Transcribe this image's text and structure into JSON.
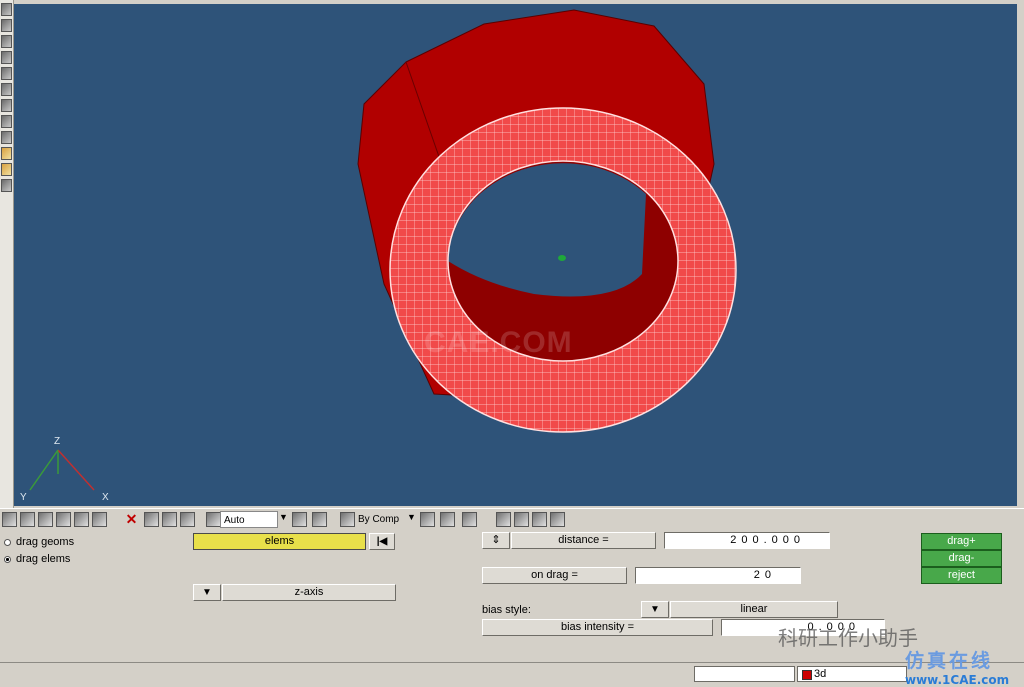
{
  "viewport": {
    "watermark": "CAE.COM",
    "axes": {
      "z_label": "Z",
      "y_label": "Y",
      "x_label": "X"
    },
    "colors": {
      "background": "#2e5379",
      "cylinder": "#b10000",
      "ring_face": "#f14a4a",
      "mesh": "#ffd8d8"
    }
  },
  "toolbar": {
    "icons": [
      "select-icon",
      "edit-icon",
      "folder-icon",
      "save-icon",
      "import-icon",
      "export-icon"
    ],
    "delete_icon": "delete-icon",
    "pick_mode": "Auto",
    "color_mode": "By Comp"
  },
  "panel": {
    "radio_drag_geoms": "drag geoms",
    "radio_drag_elems": "drag elems",
    "elems_button": "elems",
    "reset_glyph": "|◀",
    "dropdown_glyph": "▼",
    "direction_button": "z-axis",
    "updown_glyph": "⇕",
    "distance_label": "distance =",
    "distance_value": "200.000",
    "on_drag_label": "on drag =",
    "on_drag_value": "20",
    "bias_style_label": "bias style:",
    "bias_style_value": "linear",
    "bias_intensity_label": "bias intensity =",
    "bias_intensity_value": "0.000",
    "drag_plus": "drag+",
    "drag_minus": "drag-",
    "reject": "reject"
  },
  "status": {
    "component": "3d",
    "component_color": "#cc0000"
  },
  "overlay_watermark": "科研工作小助手",
  "logo": {
    "cn": "仿真在线",
    "url": "www.1CAE.com"
  }
}
